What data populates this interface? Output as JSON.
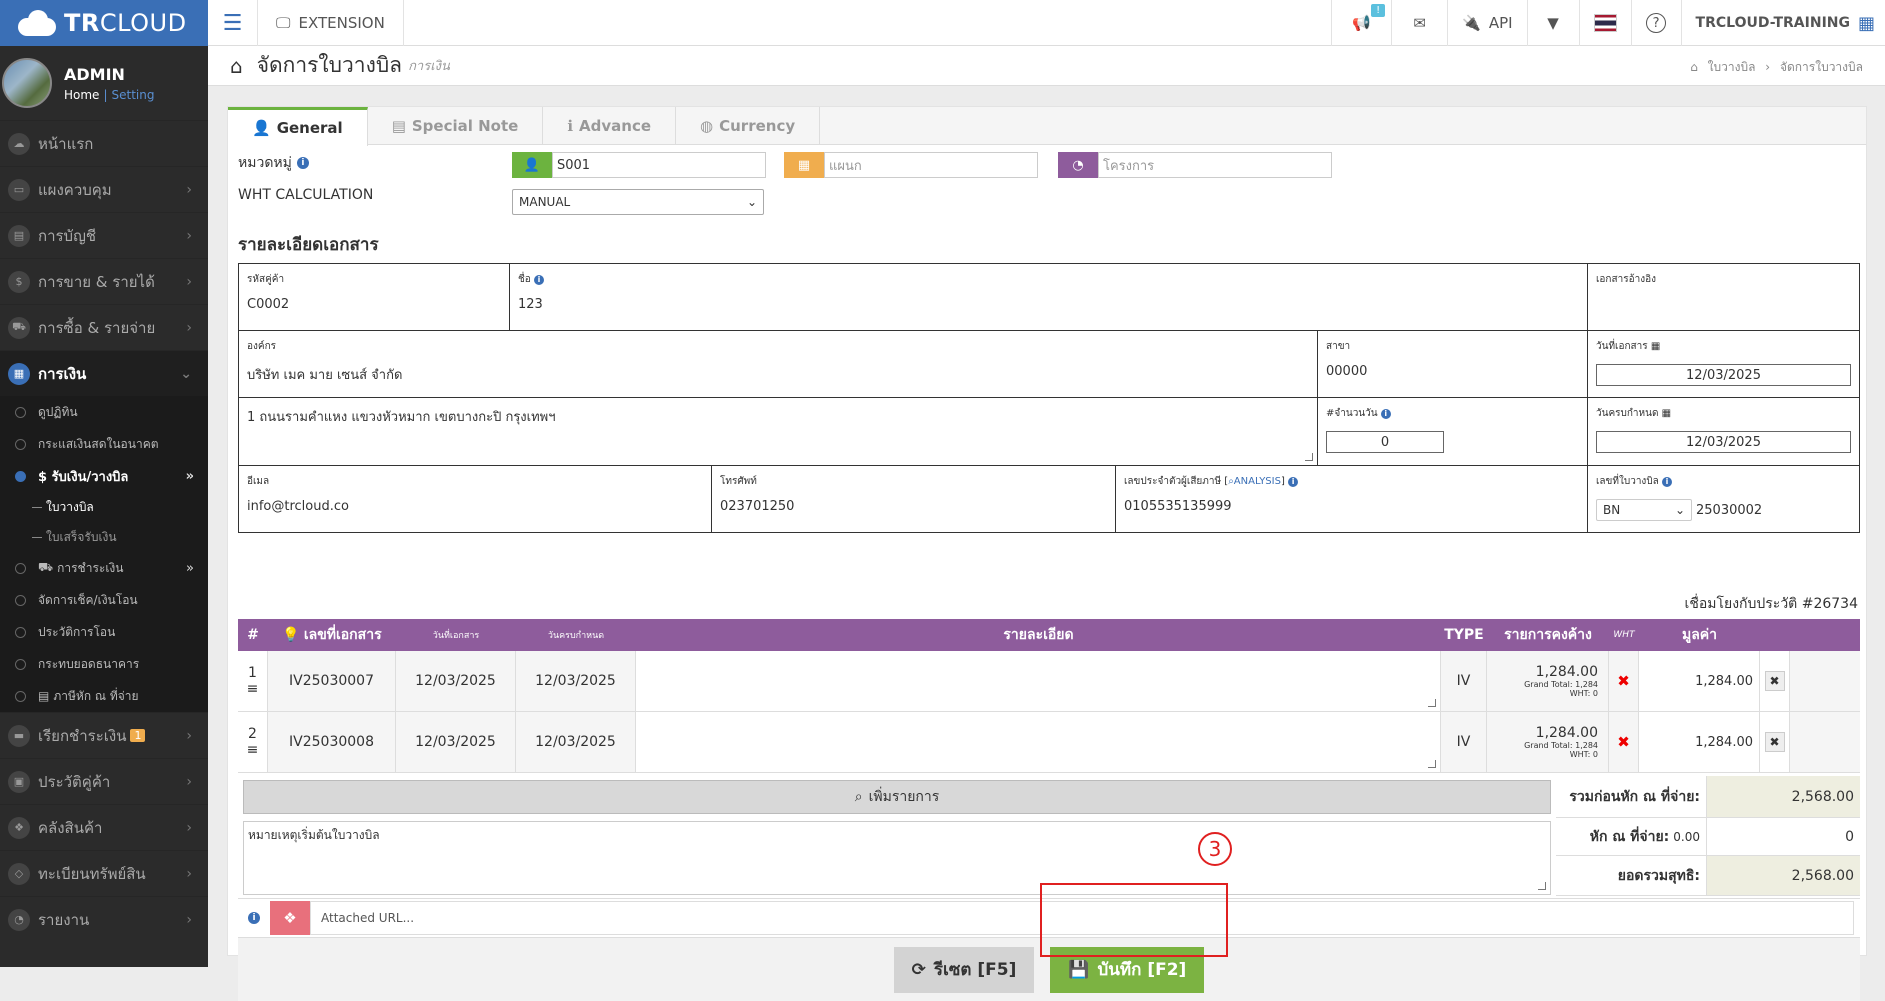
{
  "topbar": {
    "brand_bold": "TR",
    "brand_rest": "CLOUD",
    "extension": "EXTENSION",
    "notif_badge": "!",
    "api": "API",
    "user": "TRCLOUD-TRAINING"
  },
  "profile": {
    "name": "ADMIN",
    "home": "Home",
    "setting": "Setting"
  },
  "sidebar": {
    "items": [
      "หน้าแรก",
      "แผงควบคุม",
      "การบัญชี",
      "การขาย & รายได้",
      "การซื้อ & รายจ่าย",
      "การเงิน"
    ],
    "finance_sub": [
      "ดูปฏิทิน",
      "กระแสเงินสดในอนาคต",
      "$ รับเงิน/วางบิล",
      "ใบวางบิล",
      "ใบเสร็จรับเงิน",
      "การชำระเงิน",
      "จัดการเช็ค/เงินโอน",
      "ประวัติการโอน",
      "กระทบยอดธนาคาร",
      "ภาษีหัก ณ ที่จ่าย"
    ],
    "items2": [
      "เรียกชำระเงิน",
      "ประวัติคู่ค้า",
      "คลังสินค้า",
      "ทะเบียนทรัพย์สิน",
      "รายงาน"
    ],
    "billing_badge": "1"
  },
  "page": {
    "title": "จัดการใบวางบิล",
    "subtitle": "การเงิน",
    "breadcrumb_1": "ใบวางบิล",
    "breadcrumb_2": "จัดการใบวางบิล"
  },
  "tabs": [
    "General",
    "Special Note",
    "Advance",
    "Currency"
  ],
  "form": {
    "category_label": "หมวดหมู่",
    "category_value": "S001",
    "department_placeholder": "แผนก",
    "project_placeholder": "โครงการ",
    "wht_label": "WHT CALCULATION",
    "wht_value": "MANUAL",
    "section_title": "รายละเอียดเอกสาร"
  },
  "details": {
    "customer_code_label": "รหัสคู่ค้า",
    "customer_code": "C0002",
    "name_label": "ชื่อ",
    "name": "123",
    "ref_doc_label": "เอกสารอ้างอิง",
    "org_label": "องค์กร",
    "org": "บริษัท เมค มาย เซนส์ จำกัด",
    "branch_label": "สาขา",
    "branch": "00000",
    "doc_date_label": "วันที่เอกสาร",
    "doc_date": "12/03/2025",
    "address": "1 ถนนรามคำแหง แขวงหัวหมาก เขตบางกะปิ กรุงเทพฯ",
    "days_label": "#จำนวนวัน",
    "days": "0",
    "due_date_label": "วันครบกำหนด",
    "due_date": "12/03/2025",
    "email_label": "อีเมล",
    "email": "info@trcloud.co",
    "phone_label": "โทรศัพท์",
    "phone": "023701250",
    "taxid_label_1": "เลขประจำตัวผู้เสียภาษี [",
    "taxid_link": "ANALYSIS",
    "taxid_label_2": "]",
    "taxid": "0105535135999",
    "billno_label": "เลขที่ใบวางบิล",
    "bill_prefix": "BN",
    "bill_no": "25030002"
  },
  "link_history": "เชื่อมโยงกับประวัติ #26734",
  "grid": {
    "headers": {
      "no": "#",
      "docno": "เลขที่เอกสาร",
      "docdate": "วันที่เอกสาร",
      "duedate": "วันครบกำหนด",
      "desc": "รายละเอียด",
      "type": "TYPE",
      "outstanding": "รายการคงค้าง",
      "wht": "WHT",
      "value": "มูลค่า"
    },
    "rows": [
      {
        "no": "1",
        "docno": "IV25030007",
        "docdate": "12/03/2025",
        "duedate": "12/03/2025",
        "type": "IV",
        "outstanding": "1,284.00",
        "grand": "Grand Total: 1,284",
        "wht": "WHT: 0",
        "value": "1,284.00"
      },
      {
        "no": "2",
        "docno": "IV25030008",
        "docdate": "12/03/2025",
        "duedate": "12/03/2025",
        "type": "IV",
        "outstanding": "1,284.00",
        "grand": "Grand Total: 1,284",
        "wht": "WHT: 0",
        "value": "1,284.00"
      }
    ],
    "add_item": "เพิ่มรายการ"
  },
  "summary": {
    "before_wht_label": "รวมก่อนหัก ณ ที่จ่าย:",
    "before_wht": "2,568.00",
    "wht_label": "หัก ณ ที่จ่าย:",
    "wht_inline": "0.00",
    "wht_value": "0",
    "net_label": "ยอดรวมสุทธิ:",
    "net": "2,568.00"
  },
  "notes": "หมายเหตุเริ่มต้นใบวางบิล",
  "attached_url_placeholder": "Attached URL...",
  "buttons": {
    "reset": "รีเซต [F5]",
    "save": "บันทึก [F2]"
  },
  "annotation": {
    "step": "3"
  },
  "colors": {
    "brand": "#3a6fb6",
    "grid_header": "#8e5c9c",
    "save": "#7cb342",
    "highlight": "#e02020"
  }
}
